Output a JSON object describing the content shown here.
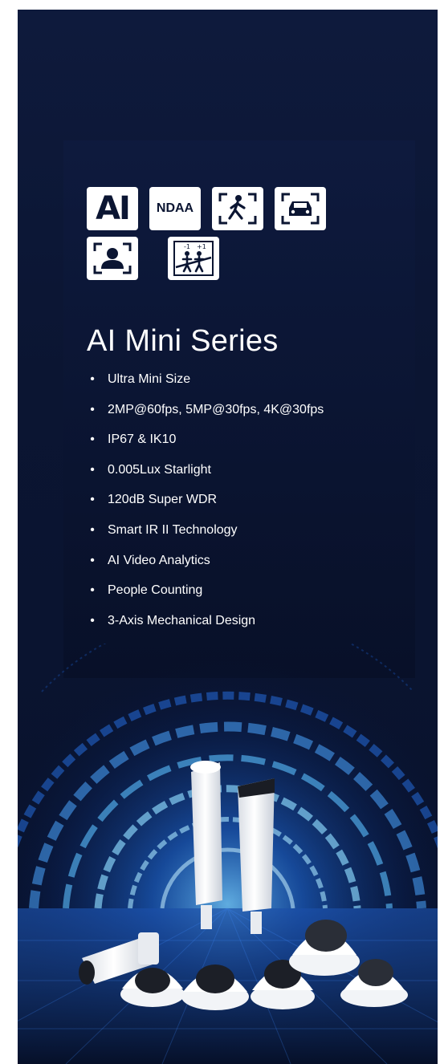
{
  "badges": [
    {
      "name": "ai-badge",
      "label": "AI",
      "icon": "ai-logo-icon"
    },
    {
      "name": "ndaa-badge",
      "label": "NDAA",
      "icon": "ndaa-icon"
    },
    {
      "name": "human-detection-badge",
      "icon": "walking-person-icon"
    },
    {
      "name": "vehicle-detection-badge",
      "icon": "car-icon"
    },
    {
      "name": "face-detection-badge",
      "icon": "person-bust-icon"
    },
    {
      "name": "people-counting-badge",
      "icon": "people-counting-icon"
    }
  ],
  "title": "AI Mini Series",
  "features": [
    "Ultra Mini Size",
    "2MP@60fps, 5MP@30fps, 4K@30fps",
    "IP67 & IK10",
    "0.005Lux Starlight",
    "120dB Super WDR",
    "Smart IR II Technology",
    "AI Video Analytics",
    "People Counting",
    "3-Axis Mechanical Design"
  ],
  "bullet": "•",
  "colors": {
    "background": "#0b1532",
    "accent_blue": "#1e7bff",
    "glow_cyan": "#7fd4ff",
    "text": "#ffffff"
  }
}
